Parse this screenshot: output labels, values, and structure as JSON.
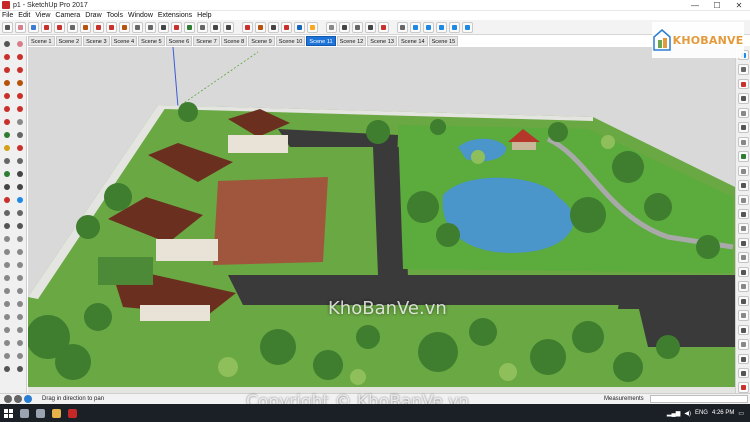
{
  "window": {
    "title": "p1 - SketchUp Pro 2017",
    "minimize": "—",
    "maximize": "☐",
    "close": "✕"
  },
  "menu": [
    "File",
    "Edit",
    "View",
    "Camera",
    "Draw",
    "Tools",
    "Window",
    "Extensions",
    "Help"
  ],
  "scenes": {
    "tabs": [
      "Scene 1",
      "Scene 2",
      "Scene 3",
      "Scene 4",
      "Scene 5",
      "Scene 6",
      "Scene 7",
      "Scene 8",
      "Scene 9",
      "Scene 10",
      "Scene 11",
      "Scene 12",
      "Scene 13",
      "Scene 14",
      "Scene 15"
    ],
    "active": "Scene 11"
  },
  "toolbar_icons": [
    "select-icon",
    "eraser-icon",
    "paint-icon",
    "line-icon",
    "arc-icon",
    "shape-icon",
    "push-pull-icon",
    "move-icon",
    "rotate-icon",
    "scale-icon",
    "offset-icon",
    "tape-icon",
    "text-icon",
    "axes-icon",
    "orbit-icon",
    "pan-icon",
    "zoom-icon",
    "zoom-extents-icon",
    "warehouse-icon",
    "extension-icon",
    "layer-icon",
    "section-icon",
    "style-icon",
    "shadow-icon",
    "fog-icon",
    "camera-icon",
    "walk-icon",
    "look-around-icon",
    "position-camera-icon",
    "iso-view-icon",
    "top-view-icon",
    "front-view-icon",
    "right-view-icon",
    "back-view-icon",
    "left-view-icon"
  ],
  "toolbar_colors": [
    "#555555",
    "#d87d8b",
    "#3b7bd6",
    "#c9302c",
    "#c9302c",
    "#666666",
    "#b45309",
    "#c9302c",
    "#c9302c",
    "#b45309",
    "#666666",
    "#666666",
    "#444444",
    "#c9302c",
    "#2e7d32",
    "#666666",
    "#444444",
    "#444444",
    "#c9302c",
    "#b45309",
    "#444444",
    "#c9302c",
    "#1565c0",
    "#f9a825",
    "#888888",
    "#444444",
    "#666666",
    "#444444",
    "#c9302c",
    "#666666",
    "#1e88e5",
    "#1e88e5",
    "#1e88e5",
    "#1e88e5",
    "#1e88e5"
  ],
  "left_tool_colors": [
    "#555555",
    "#d87d8b",
    "#c9302c",
    "#c9302c",
    "#c9302c",
    "#c9302c",
    "#b45309",
    "#b45309",
    "#c9302c",
    "#c9302c",
    "#c9302c",
    "#c9302c",
    "#c9302c",
    "#888888",
    "#2e7d32",
    "#666666",
    "#d4a017",
    "#c9302c",
    "#666666",
    "#666666",
    "#2e7d32",
    "#444444",
    "#444444",
    "#444444",
    "#c9302c",
    "#1e88e5",
    "#666666",
    "#666666",
    "#555555",
    "#555555",
    "#888888",
    "#888888",
    "#888888",
    "#888888",
    "#888888",
    "#888888",
    "#888888",
    "#888888",
    "#888888",
    "#888888",
    "#888888",
    "#888888",
    "#888888",
    "#888888",
    "#888888",
    "#888888",
    "#888888",
    "#888888",
    "#888888",
    "#888888",
    "#555555",
    "#555555"
  ],
  "right_tray_colors": [
    "#1e88e5",
    "#666666",
    "#c9302c",
    "#555555",
    "#888888",
    "#555555",
    "#888888",
    "#2e7d32",
    "#888888",
    "#555555",
    "#888888",
    "#555555",
    "#888888",
    "#555555",
    "#888888",
    "#555555",
    "#888888",
    "#555555",
    "#888888",
    "#555555",
    "#888888",
    "#555555",
    "#555555",
    "#c9302c"
  ],
  "logo": {
    "text": "KHOBANVE",
    "colors": {
      "orange": "#e49a3a",
      "green": "#6aa84f",
      "blue": "#2a7fd4"
    }
  },
  "watermark_center": "KhoBanVe.vn",
  "copyright": "Copyright © KhoBanVe.vn",
  "status": {
    "hint": "Drag in direction to pan",
    "measurements_label": "Measurements"
  },
  "taskbar": {
    "apps": [
      "search-icon",
      "task-view-icon",
      "file-explorer-icon",
      "sketchup-icon"
    ],
    "app_colors": [
      "#9aa4b0",
      "#9aa4b0",
      "#e6b34a",
      "#c62828"
    ],
    "language": "ENG",
    "time": "4:26 PM"
  },
  "colors": {
    "scene_active": "#1e74d9",
    "road": "#3a3a3a",
    "grass": "#5aa83a",
    "water": "#4a95c9",
    "roof": "#6b2f1f",
    "brick": "#a0563c",
    "wall": "#e4e4e0"
  }
}
